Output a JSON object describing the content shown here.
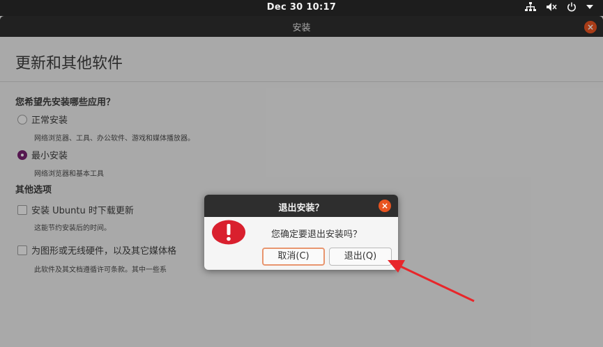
{
  "topbar": {
    "clock": "Dec 30  10:17",
    "tray_icons": [
      "network-icon",
      "volume-muted-icon",
      "power-icon",
      "menu-arrow-icon"
    ]
  },
  "window": {
    "title": "安装",
    "close_glyph": "×"
  },
  "page": {
    "title": "更新和其他软件",
    "question": "您希望先安装哪些应用？",
    "normal_install": {
      "label": "正常安装",
      "desc": "网络浏览器、工具、办公软件、游戏和媒体播放器。",
      "selected": false
    },
    "minimal_install": {
      "label": "最小安装",
      "desc": "网络浏览器和基本工具",
      "selected": true
    },
    "other_options": "其他选项",
    "download_updates": {
      "label": "安装 Ubuntu 时下载更新",
      "desc": "这能节约安装后的时间。",
      "checked": false
    },
    "third_party": {
      "label": "为图形或无线硬件，以及其它媒体格",
      "desc": "此软件及其文档遵循许可条款。其中一些系",
      "checked": false
    }
  },
  "dialog": {
    "title": "退出安装？",
    "close_glyph": "×",
    "icon": "error-icon",
    "message": "您确定要退出安装吗？",
    "cancel_label": "取消(C)",
    "quit_label": "退出(Q)"
  },
  "colors": {
    "accent_orange": "#e95420",
    "radio_selected": "#77216f",
    "error_red": "#d9202e",
    "arrow_red": "#e8262a"
  }
}
